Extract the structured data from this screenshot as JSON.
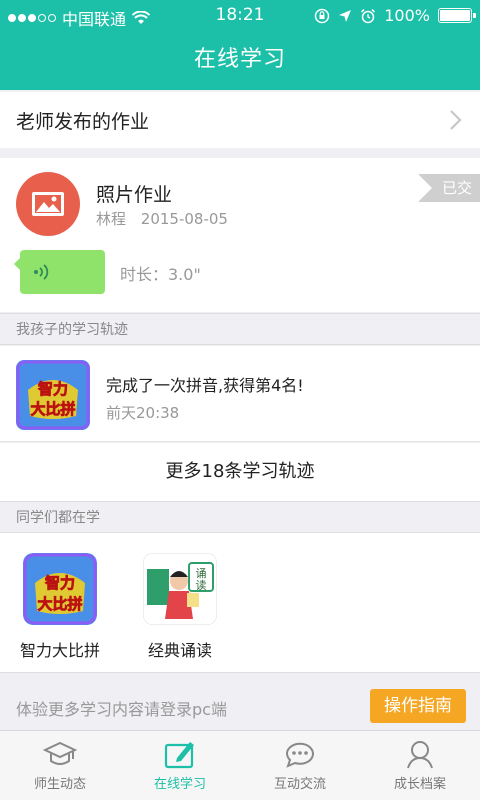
{
  "status_bar": {
    "carrier": "中国联通",
    "time": "18:21",
    "battery": "100%"
  },
  "nav": {
    "title": "在线学习"
  },
  "homework_row": {
    "label": "老师发布的作业"
  },
  "homework_card": {
    "title": "照片作业",
    "teacher": "林程",
    "date": "2015-08-05",
    "badge": "已交",
    "duration": "时长：3.0\""
  },
  "sections": {
    "track": "我孩子的学习轨迹",
    "classmates": "同学们都在学"
  },
  "track_item": {
    "text": "完成了一次拼音,获得第4名!",
    "time": "前天20:38"
  },
  "more_link": "更多18条学习轨迹",
  "apps": [
    {
      "label": "智力大比拼"
    },
    {
      "label": "经典诵读"
    }
  ],
  "login_bar": {
    "text": "体验更多学习内容请登录pc端",
    "button": "操作指南"
  },
  "tabbar": {
    "items": [
      {
        "label": "师生动态",
        "icon": "graduation-cap-icon"
      },
      {
        "label": "在线学习",
        "icon": "pencil-tablet-icon"
      },
      {
        "label": "互动交流",
        "icon": "chat-bubble-icon"
      },
      {
        "label": "成长档案",
        "icon": "person-icon"
      }
    ]
  },
  "colors": {
    "primary": "#1cbfa7",
    "accent": "#f5a623",
    "voice": "#8fe36a",
    "photo_icon": "#e8604b"
  }
}
